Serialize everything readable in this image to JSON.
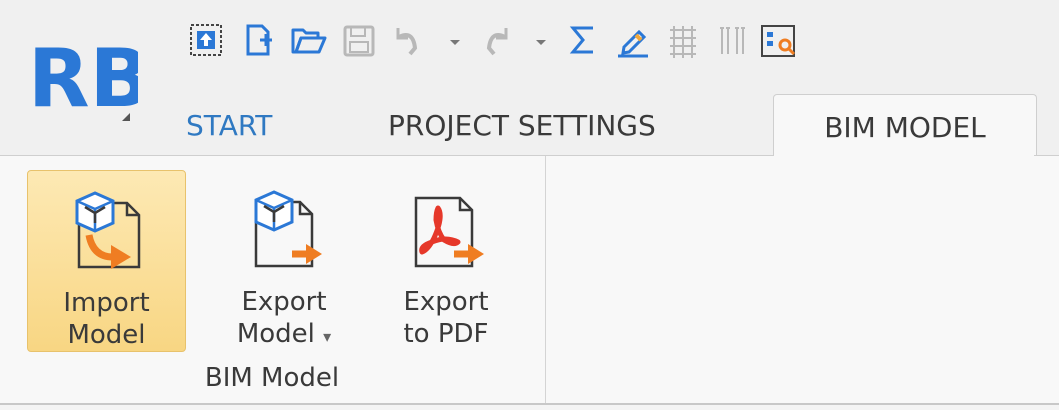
{
  "logo": {
    "text": "RB"
  },
  "quick_access": [
    {
      "name": "upload-icon"
    },
    {
      "name": "new-file-icon"
    },
    {
      "name": "open-folder-icon"
    },
    {
      "name": "save-icon"
    },
    {
      "name": "undo-icon"
    },
    {
      "name": "undo-dropdown-icon"
    },
    {
      "name": "redo-icon"
    },
    {
      "name": "redo-dropdown-icon"
    },
    {
      "name": "sum-icon"
    },
    {
      "name": "edit-icon"
    },
    {
      "name": "grid-icon"
    },
    {
      "name": "columns-icon"
    },
    {
      "name": "preview-icon"
    }
  ],
  "tabs": [
    {
      "label": "START",
      "active": false
    },
    {
      "label": "PROJECT SETTINGS",
      "active": false
    },
    {
      "label": "BIM MODEL",
      "active": true
    }
  ],
  "ribbon": {
    "group_label": "BIM Model",
    "buttons": [
      {
        "label": "Import\nModel",
        "icon": "import-model-icon",
        "highlighted": true
      },
      {
        "label": "Export\nModel",
        "dropdown": "▾",
        "icon": "export-model-icon",
        "highlighted": false
      },
      {
        "label": "Export\nto PDF",
        "icon": "export-pdf-icon",
        "highlighted": false
      }
    ]
  },
  "colors": {
    "accent_blue": "#2f79c2",
    "logo_blue": "#2b78d6",
    "arrow_orange": "#ef7d22",
    "pdf_red": "#e6382a",
    "highlight": "#f8d683"
  }
}
